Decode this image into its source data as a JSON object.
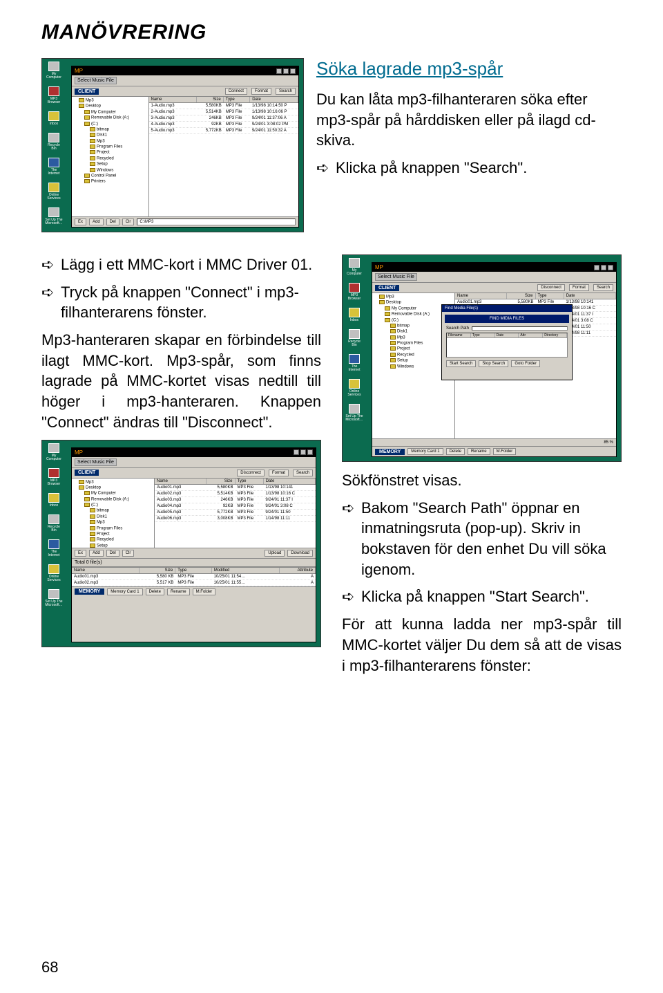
{
  "page": {
    "heading": "MANÖVRERING",
    "section_title": "Söka lagrade mp3-spår",
    "intro": "Du kan låta mp3-filhanteraren söka efter mp3-spår på hårddisken eller på ilagd cd-skiva.",
    "bullet_search": "Klicka på knappen \"Search\".",
    "bullet_insert": "Lägg i ett MMC-kort i MMC Driver 01.",
    "bullet_connect": "Tryck på knappen \"Connect\" i mp3-filhanterarens fönster.",
    "para_connect": "Mp3-hanteraren skapar en förbindelse till ilagt MMC-kort. Mp3-spår, som finns lagrade på MMC-kortet visas nedtill till höger i mp3-hanteraren. Knappen \"Connect\" ändras till \"Disconnect\".",
    "para_searchwin": "Sökfönstret visas.",
    "bullet_path": "Bakom \"Search Path\" öppnar en inmatningsruta (pop-up). Skriv in bokstaven för den enhet Du vill söka igenom.",
    "bullet_start": "Klicka på knappen \"Start Search\".",
    "para_load": "För att kunna ladda ner mp3-spår till MMC-kortet väljer Du dem så att de visas i mp3-filhanterarens fönster:",
    "page_number": "68",
    "arrow": "➪"
  },
  "screenshot": {
    "titlebar_left": "MP",
    "titlebar_select": "Select Music File",
    "client_label": "CLIENT",
    "btn_connect": "Connect",
    "btn_disconnect": "Disconnect",
    "btn_format": "Format",
    "btn_search": "Search",
    "btn_upload": "Upload",
    "btn_download": "Download",
    "tree_top": "Mp3",
    "tree_nodes": [
      "Desktop",
      "My Computer",
      "Removable Disk (A:)",
      "(C:)",
      "bitmap",
      "Disk1",
      "Mp3",
      "Program Files",
      "Project",
      "Recycled",
      "Setup",
      "Windows",
      "Control Panel",
      "Printers"
    ],
    "list_headers": {
      "name": "Name",
      "size": "Size",
      "type": "Type",
      "date": "Date"
    },
    "list1": [
      {
        "n": "1-Audio.mp3",
        "s": "5,580KB",
        "t": "MP3 File",
        "d": "1/13/98 10:14:50 P"
      },
      {
        "n": "2-Audio.mp3",
        "s": "5,514KB",
        "t": "MP3 File",
        "d": "1/13/98 10:16:06 P"
      },
      {
        "n": "3-Audio.mp3",
        "s": "246KB",
        "t": "MP3 File",
        "d": "9/24/01 11:37:06 A"
      },
      {
        "n": "4-Audio.mp3",
        "s": "92KB",
        "t": "MP3 File",
        "d": "9/24/01 3:08:02 PM"
      },
      {
        "n": "5-Audio.mp3",
        "s": "5,772KB",
        "t": "MP3 File",
        "d": "9/24/01 11:50:32 A"
      }
    ],
    "bottom_btns": [
      "Ex",
      "Add",
      "Del",
      "Clr"
    ],
    "path_value": "C:\\MP3",
    "memory_label": "MEMORY",
    "memcard": "Memory Card 1",
    "mem_btns": [
      "Delete",
      "Rename",
      "M.Folder"
    ],
    "total_label": "Total 0 file(s)",
    "list2": [
      {
        "n": "Audio01.mp3",
        "s": "5,580KB",
        "t": "MP3 File",
        "d": "1/13/98 10:141"
      },
      {
        "n": "Audio02.mp3",
        "s": "5,514KB",
        "t": "MP3 File",
        "d": "1/13/98 10:16 C"
      },
      {
        "n": "Audio03.mp3",
        "s": "246KB",
        "t": "MP3 File",
        "d": "9/24/01 11:37 I"
      },
      {
        "n": "Audio04.mp3",
        "s": "92KB",
        "t": "MP3 File",
        "d": "9/24/01 3:08 C"
      },
      {
        "n": "Audio05.mp3",
        "s": "5,772KB",
        "t": "MP3 File",
        "d": "9/24/01 11:50"
      },
      {
        "n": "Audio06.mp3",
        "s": "3,008KB",
        "t": "MP3 File",
        "d": "1/14/98 11:11"
      }
    ],
    "lower_headers": {
      "name": "Name",
      "size": "Size",
      "type": "Type",
      "mod": "Modified",
      "attr": "Attribute"
    },
    "lower_rows": [
      {
        "n": "Audio01.mp3",
        "s": "5,580 KB",
        "t": "MP3 File",
        "m": "10/25/01 11:54…",
        "a": "A"
      },
      {
        "n": "Audio02.mp3",
        "s": "5,517 KB",
        "t": "MP3 File",
        "m": "10/25/01 11:55…",
        "a": "A"
      }
    ],
    "mem_status": "85 %",
    "desk_labels": [
      "My Computer",
      "MP3 Browser",
      "Inbox",
      "Recycle Bin",
      "The Internet",
      "Online Services",
      "Set Up The Microsoft…"
    ]
  },
  "dialog": {
    "title": "Find Media File(s)",
    "banner": "FIND MIDIA FILES",
    "search_path_label": "Search Path",
    "search_path_value": "",
    "cols": [
      "Filename",
      "Type",
      "Date",
      "Attr",
      "Directory"
    ],
    "btn_start": "Start Search",
    "btn_stop": "Stop Search",
    "btn_goto": "Goto Folder"
  }
}
